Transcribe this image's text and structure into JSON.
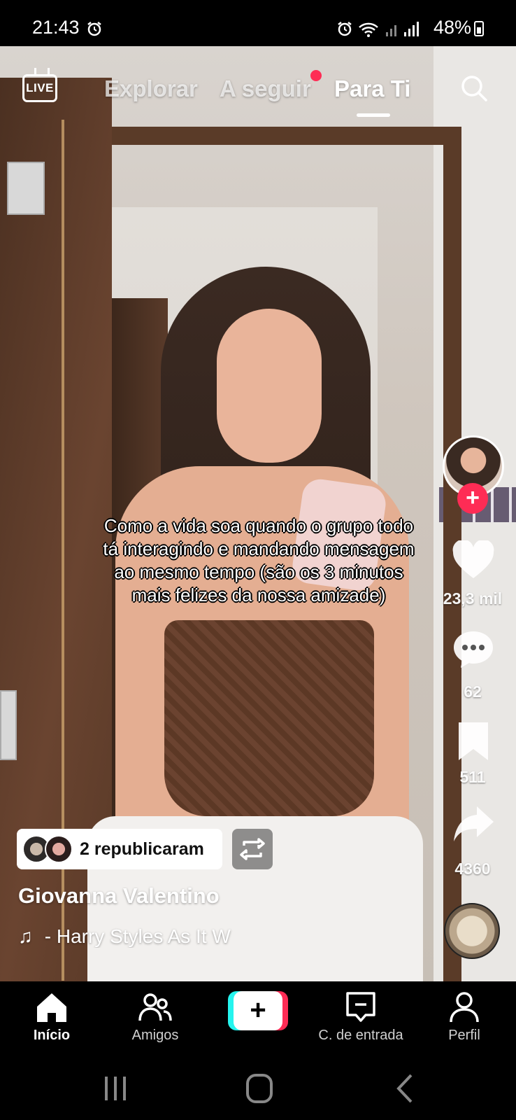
{
  "status_bar": {
    "time": "21:43",
    "battery": "48%",
    "icons": [
      "alarm-icon",
      "wifi-icon",
      "signal-icon",
      "battery-icon"
    ]
  },
  "top_nav": {
    "live_label": "LIVE",
    "tabs": [
      {
        "label": "Explorar",
        "active": false
      },
      {
        "label": "A seguir",
        "active": false,
        "notification_dot": true
      },
      {
        "label": "Para Ti",
        "active": true
      }
    ]
  },
  "video": {
    "caption": "Como a vida soa quando o grupo todo tá interagindo e mandando mensagem ao mesmo tempo (são os 3 minutos mais felizes da nossa amizade)"
  },
  "actions": {
    "likes": "23,3 mil",
    "comments": "62",
    "saves": "511",
    "shares": "4360"
  },
  "repost": {
    "label": "2 republicaram"
  },
  "post": {
    "author": "Giovanna Valentino",
    "music": "- Harry Styles    As It W"
  },
  "bottom_nav": {
    "items": [
      {
        "label": "Início",
        "icon": "home-icon",
        "active": true
      },
      {
        "label": "Amigos",
        "icon": "friends-icon",
        "active": false
      },
      {
        "label": "",
        "icon": "create-icon",
        "active": false
      },
      {
        "label": "C. de entrada",
        "icon": "inbox-icon",
        "active": false
      },
      {
        "label": "Perfil",
        "icon": "profile-icon",
        "active": false
      }
    ]
  },
  "colors": {
    "accent": "#fe2c55",
    "cyan": "#25f4ee",
    "background": "#000000"
  }
}
